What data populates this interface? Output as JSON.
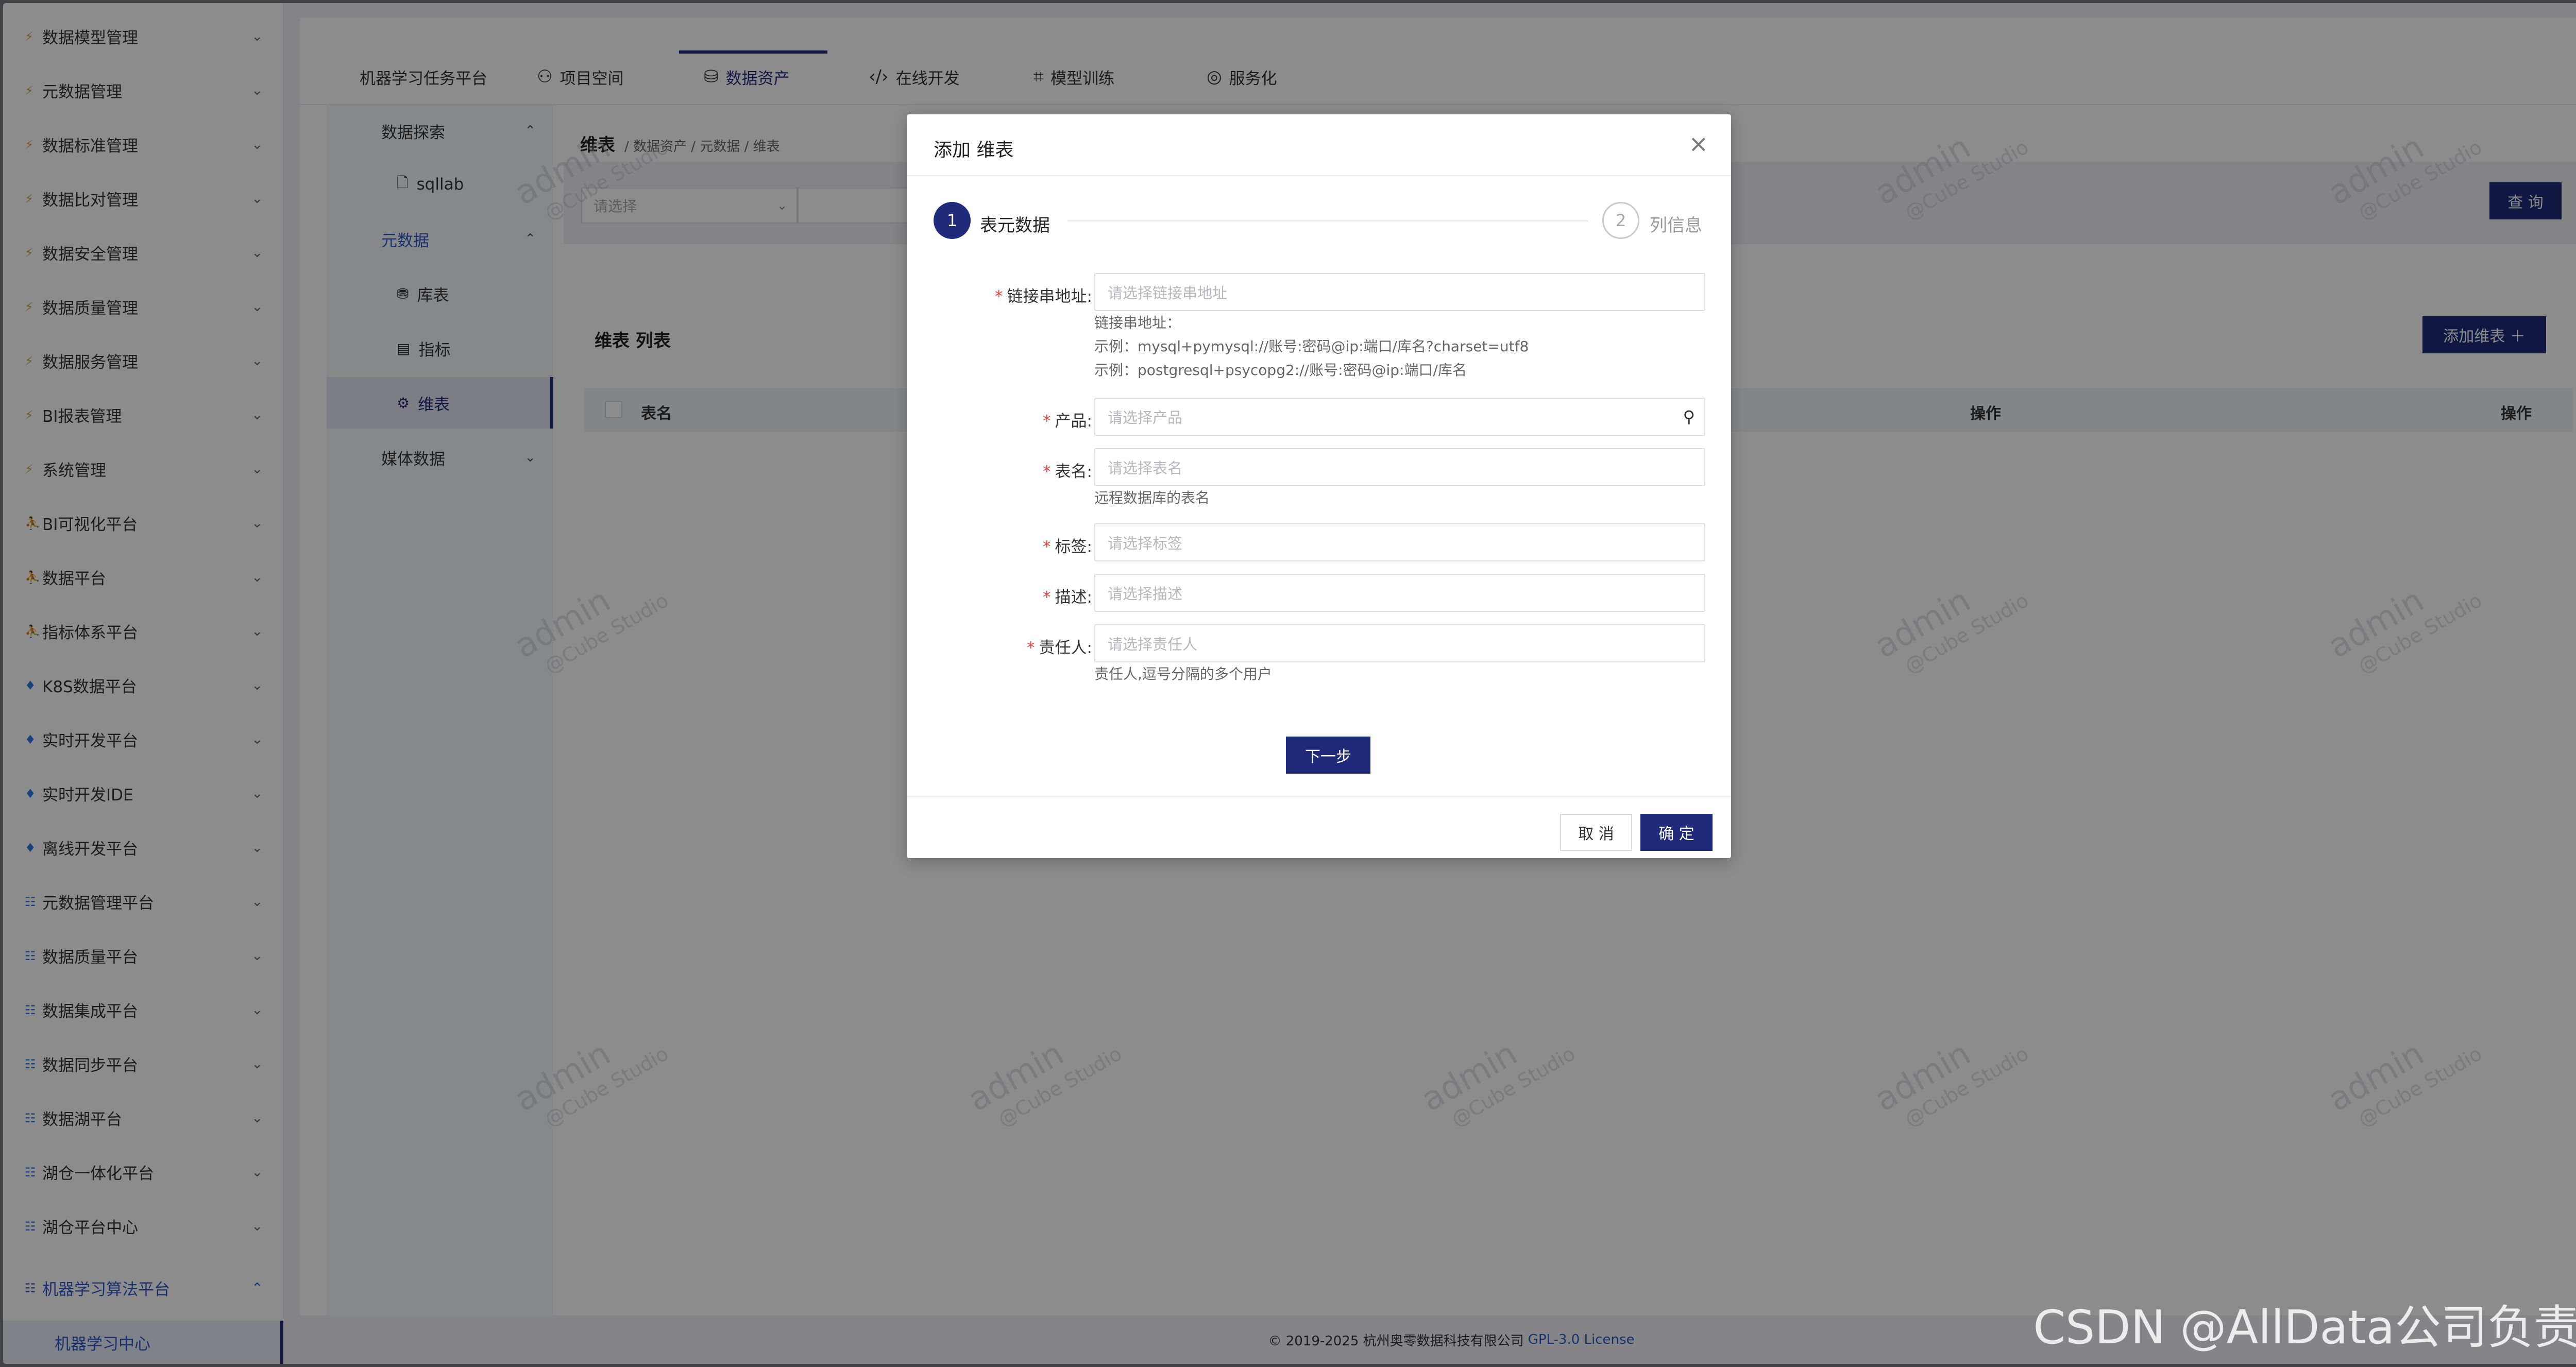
{
  "sidebar": {
    "items": [
      {
        "label": "数据模型管理",
        "icon": "bolt-icon"
      },
      {
        "label": "元数据管理",
        "icon": "bolt-icon"
      },
      {
        "label": "数据标准管理",
        "icon": "bolt-icon"
      },
      {
        "label": "数据比对管理",
        "icon": "bolt-icon"
      },
      {
        "label": "数据安全管理",
        "icon": "bolt-icon"
      },
      {
        "label": "数据质量管理",
        "icon": "bolt-icon"
      },
      {
        "label": "数据服务管理",
        "icon": "bolt-icon"
      },
      {
        "label": "BI报表管理",
        "icon": "bolt-icon"
      },
      {
        "label": "系统管理",
        "icon": "bolt-icon"
      },
      {
        "label": "BI可视化平台",
        "icon": "person-icon"
      },
      {
        "label": "数据平台",
        "icon": "person-icon"
      },
      {
        "label": "指标体系平台",
        "icon": "person-icon"
      },
      {
        "label": "K8S数据平台",
        "icon": "diamond-icon"
      },
      {
        "label": "实时开发平台",
        "icon": "diamond-icon"
      },
      {
        "label": "实时开发IDE",
        "icon": "diamond-icon"
      },
      {
        "label": "离线开发平台",
        "icon": "diamond-icon"
      },
      {
        "label": "元数据管理平台",
        "icon": "grid-icon"
      },
      {
        "label": "数据质量平台",
        "icon": "grid-icon"
      },
      {
        "label": "数据集成平台",
        "icon": "grid-icon"
      },
      {
        "label": "数据同步平台",
        "icon": "grid-icon"
      },
      {
        "label": "数据湖平台",
        "icon": "grid-icon"
      },
      {
        "label": "湖仓一体化平台",
        "icon": "grid-icon"
      },
      {
        "label": "湖仓平台中心",
        "icon": "grid-icon"
      },
      {
        "label": "机器学习算法平台",
        "icon": "grid-icon"
      }
    ],
    "sub_item": "机器学习中心"
  },
  "topnav": {
    "tabs": [
      {
        "label": "机器学习任务平台"
      },
      {
        "label": "项目空间",
        "icon": "team-icon"
      },
      {
        "label": "数据资产",
        "icon": "database-icon"
      },
      {
        "label": "在线开发",
        "icon": "code-icon"
      },
      {
        "label": "模型训练",
        "icon": "training-icon"
      },
      {
        "label": "服务化",
        "icon": "service-icon"
      }
    ]
  },
  "subnav": {
    "explore": "数据探索",
    "sqllab": "sqllab",
    "meta": "元数据",
    "table": "库表",
    "metric": "指标",
    "dim": "维表",
    "media": "媒体数据"
  },
  "content": {
    "title": "维表",
    "crumbs": "/ 数据资产 / 元数据 / 维表",
    "select_placeholder": "请选择",
    "query": "查 询",
    "list_title": "维表 列表",
    "add_button": "添加维表 ＋",
    "col_name": "表名",
    "col_op1": "操作",
    "col_op2": "操作"
  },
  "footer": {
    "text": "© 2019-2025 杭州奥零数据科技有限公司",
    "license": "GPL-3.0 License"
  },
  "watermark": {
    "line1": "admin",
    "line2": "@Cube Studio"
  },
  "modal": {
    "title": "添加 维表",
    "step1_num": "1",
    "step1_label": "表元数据",
    "step2_num": "2",
    "step2_label": "列信息",
    "fields": {
      "conn": {
        "label": "链接串地址:",
        "placeholder": "请选择链接串地址"
      },
      "conn_help1": "链接串地址：",
      "conn_help2": "示例：mysql+pymysql://账号:密码@ip:端口/库名?charset=utf8",
      "conn_help3": "示例：postgresql+psycopg2://账号:密码@ip:端口/库名",
      "product": {
        "label": "产品:",
        "placeholder": "请选择产品"
      },
      "table": {
        "label": "表名:",
        "placeholder": "请选择表名"
      },
      "table_help": "远程数据库的表名",
      "tag": {
        "label": "标签:",
        "placeholder": "请选择标签"
      },
      "desc": {
        "label": "描述:",
        "placeholder": "请选择描述"
      },
      "owner": {
        "label": "责任人:",
        "placeholder": "请选择责任人"
      },
      "owner_help": "责任人,逗号分隔的多个用户"
    },
    "next": "下一步",
    "cancel": "取 消",
    "ok": "确 定"
  },
  "csdn": "CSDN @AllData公司负责人"
}
